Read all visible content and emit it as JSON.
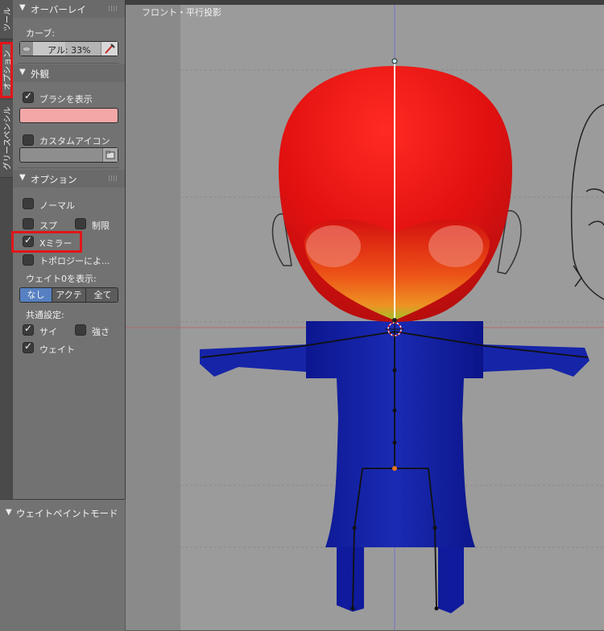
{
  "tabs": [
    {
      "label": "ツール",
      "active": false
    },
    {
      "label": "オプション",
      "active": true
    },
    {
      "label": "グリースペンシル",
      "active": false
    }
  ],
  "overlay": {
    "title": "オーバーレイ",
    "curve_label": "カーブ:",
    "alpha_field": "アル: 33%"
  },
  "appearance": {
    "title": "外観",
    "show_brush_label": "ブラシを表示",
    "show_brush_checked": true,
    "brush_color": "#f4a7a7",
    "custom_icon_label": "カスタムアイコン",
    "custom_icon_checked": false
  },
  "options": {
    "title": "オプション",
    "normal_label": "ノーマル",
    "spray_label": "スプ",
    "restrict_label": "制限",
    "x_mirror_label": "Xミラー",
    "x_mirror_checked": true,
    "topology_label": "トポロジーによ...",
    "show_zero_weight_label": "ウェイト0を表示:",
    "zero_weight_options": [
      "なし",
      "アクテ",
      "全て"
    ],
    "zero_weight_selected": 0,
    "common_label": "共通設定:",
    "size_label": "サイ",
    "strength_label": "強さ",
    "weight_label": "ウェイト"
  },
  "lower_panel": {
    "title": "ウェイトペイントモード"
  },
  "viewport": {
    "title": "フロント・平行投影"
  },
  "colors": {
    "highlight_red": "#e0161a",
    "accent_blue": "#5680c2"
  }
}
